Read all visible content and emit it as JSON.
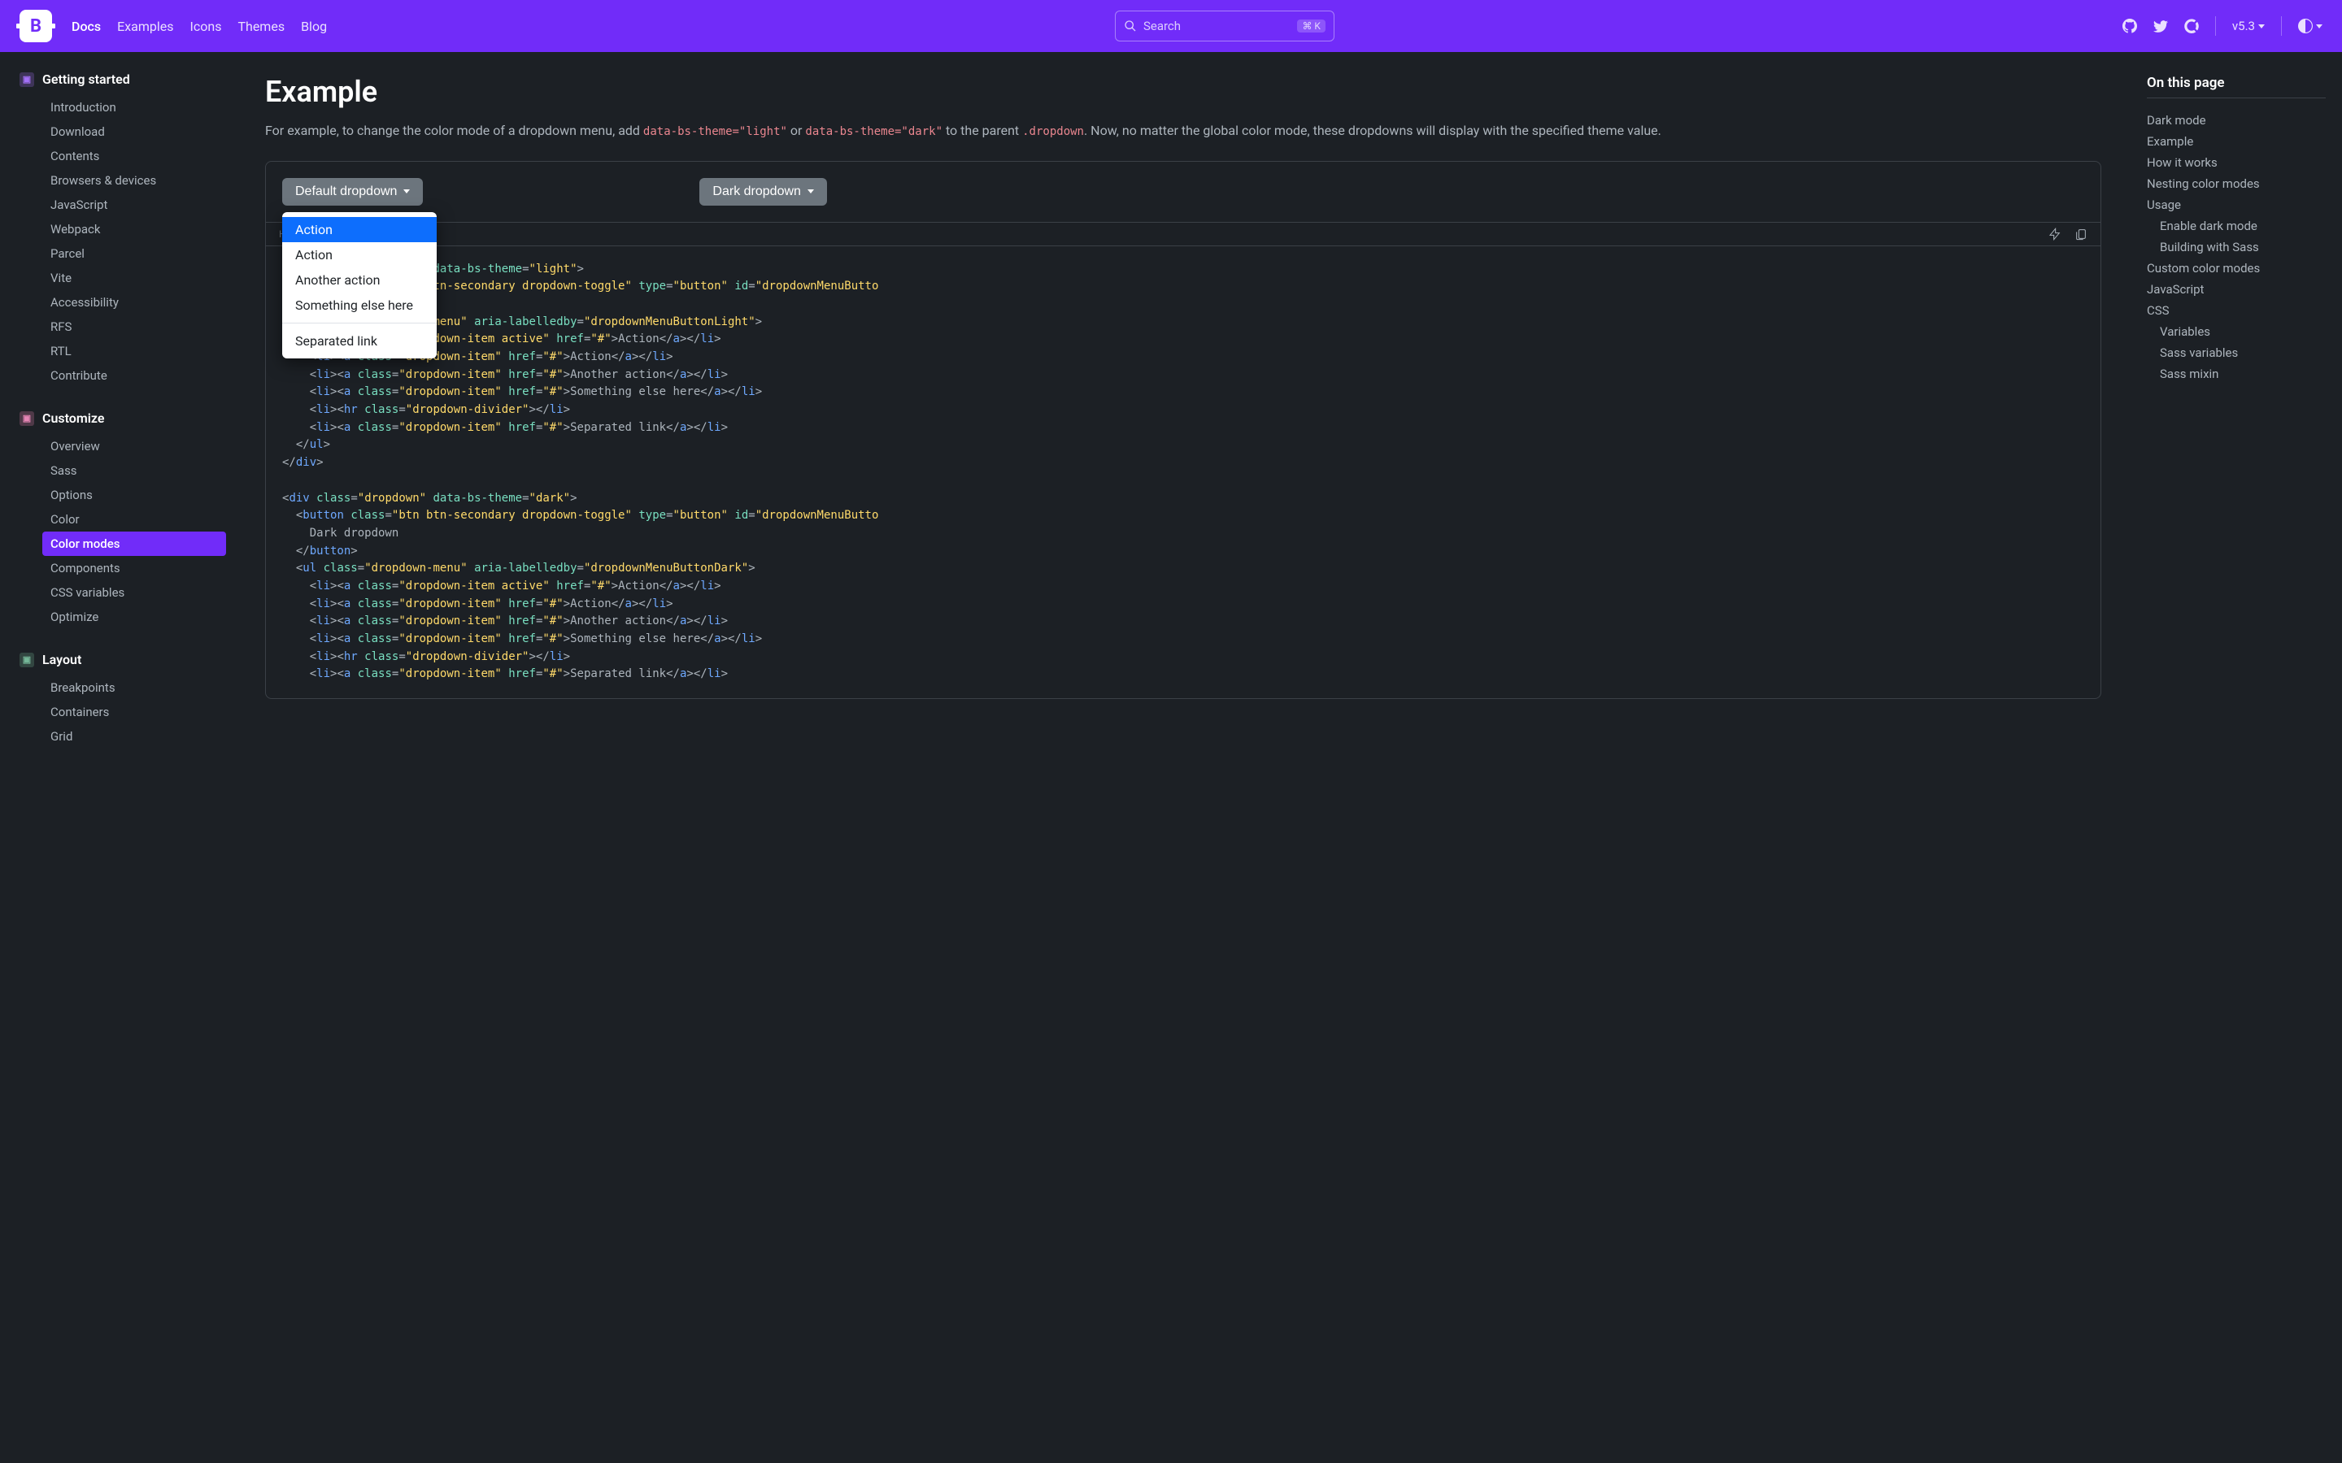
{
  "navbar": {
    "links": [
      "Docs",
      "Examples",
      "Icons",
      "Themes",
      "Blog"
    ],
    "search_placeholder": "Search",
    "search_kbd": "⌘ K",
    "version": "v5.3"
  },
  "sidebar_left": [
    {
      "title": "Getting started",
      "color": "#a370f7",
      "items": [
        "Introduction",
        "Download",
        "Contents",
        "Browsers & devices",
        "JavaScript",
        "Webpack",
        "Parcel",
        "Vite",
        "Accessibility",
        "RFS",
        "RTL",
        "Contribute"
      ]
    },
    {
      "title": "Customize",
      "color": "#e685b5",
      "items": [
        "Overview",
        "Sass",
        "Options",
        "Color",
        "Color modes",
        "Components",
        "CSS variables",
        "Optimize"
      ],
      "active": 4
    },
    {
      "title": "Layout",
      "color": "#75b798",
      "items": [
        "Breakpoints",
        "Containers",
        "Grid"
      ]
    }
  ],
  "main": {
    "heading": "Example",
    "intro_pre": "For example, to change the color mode of a dropdown menu, add ",
    "intro_code1": "data-bs-theme=\"light\"",
    "intro_mid": " or ",
    "intro_code2": "data-bs-theme=\"dark\"",
    "intro_post": " to the parent ",
    "intro_code3": ".dropdown",
    "intro_end": ". Now, no matter the global color mode, these dropdowns will display with the specified theme value.",
    "dd1_label": "Default dropdown",
    "dd2_label": "Dark dropdown",
    "dd_menu": [
      "Action",
      "Action",
      "Another action",
      "Something else here",
      "---",
      "Separated link"
    ],
    "toolbar_label": "HTML"
  },
  "toc": {
    "title": "On this page",
    "items": [
      {
        "label": "Dark mode"
      },
      {
        "label": "Example"
      },
      {
        "label": "How it works"
      },
      {
        "label": "Nesting color modes"
      },
      {
        "label": "Usage"
      },
      {
        "label": "Enable dark mode",
        "sub": true
      },
      {
        "label": "Building with Sass",
        "sub": true
      },
      {
        "label": "Custom color modes"
      },
      {
        "label": "JavaScript"
      },
      {
        "label": "CSS"
      },
      {
        "label": "Variables",
        "sub": true
      },
      {
        "label": "Sass variables",
        "sub": true
      },
      {
        "label": "Sass mixin",
        "sub": true
      }
    ]
  }
}
